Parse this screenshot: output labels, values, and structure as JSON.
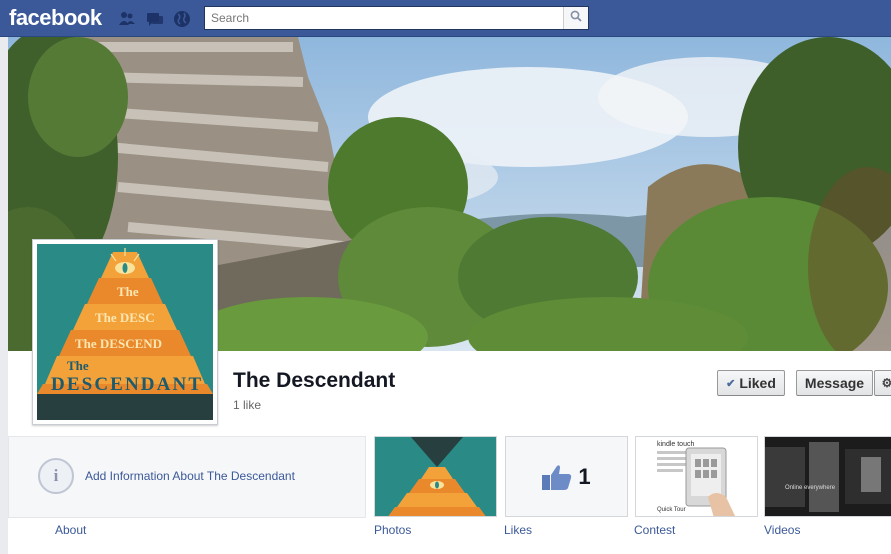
{
  "topbar": {
    "logo": "facebook",
    "search": {
      "placeholder": "Search",
      "value": ""
    },
    "icons": [
      "friend-requests-icon",
      "messages-icon",
      "notifications-globe-icon",
      "search-icon"
    ]
  },
  "page": {
    "name": "The Descendant",
    "likes_text": "1 like",
    "buttons": {
      "liked": "Liked",
      "message": "Message"
    },
    "about": {
      "add_info": "Add Information About The Descendant",
      "tab": "About"
    },
    "apps": [
      {
        "label": "Photos"
      },
      {
        "label": "Likes",
        "count": "1"
      },
      {
        "label": "Contest"
      },
      {
        "label": "Videos"
      }
    ],
    "profile_art_text": {
      "line1": "The",
      "line2": "The DESC",
      "line3": "The DESCEND",
      "line4": "The",
      "line5": "DESCENDANT"
    },
    "contest_thumb_text": {
      "brand": "kindle touch",
      "tour": "Quick Tour"
    },
    "videos_thumb_text": "Online everywhere"
  },
  "colors": {
    "brand_blue": "#3b5998",
    "link_blue": "#3b5998",
    "teal": "#2a8a86",
    "orange": "#e9892b"
  }
}
